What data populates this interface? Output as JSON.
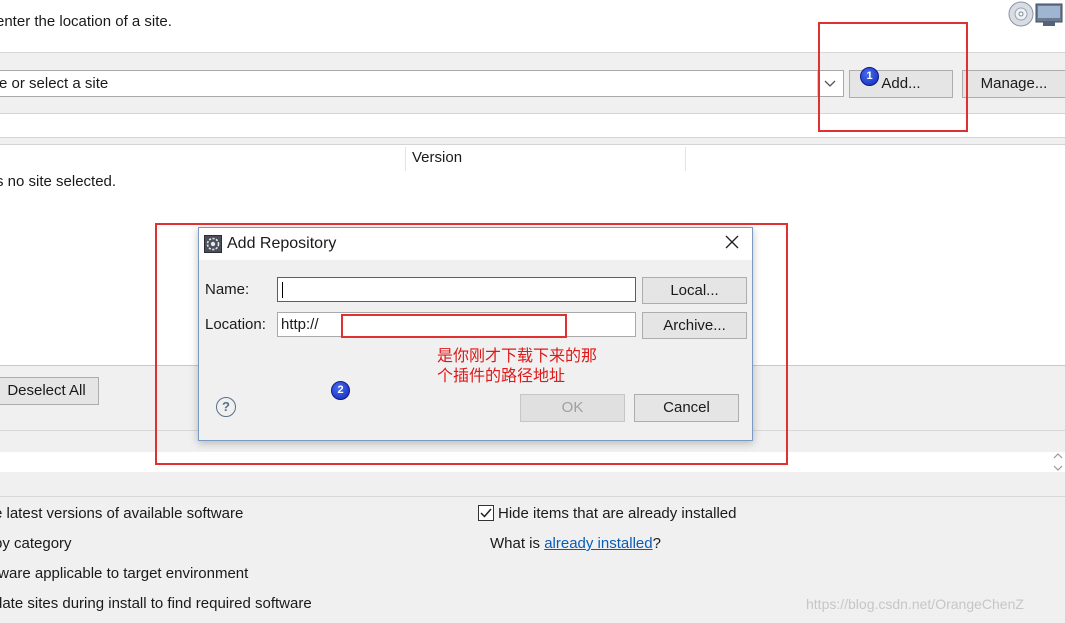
{
  "header": {
    "instruction": "enter the location of a site."
  },
  "site_selector": {
    "text": "e or select a site",
    "dropdown_icon": "chevron-down-icon",
    "add_label": "Add...",
    "manage_label": "Manage..."
  },
  "table": {
    "columns": [
      "Version"
    ],
    "empty_message": "s no site selected."
  },
  "actions": {
    "deselect_all_label": "Deselect All"
  },
  "options": {
    "items": [
      "e latest versions of available software",
      "by category",
      "tware applicable to target environment",
      "date sites during install to find required software"
    ],
    "hide_installed": {
      "label": "Hide items that are already installed",
      "checked": true
    },
    "what_is_prefix": "What is ",
    "already_installed_link": "already installed",
    "what_is_suffix": "?"
  },
  "dialog": {
    "title": "Add Repository",
    "close_icon": "close-icon",
    "name_label": "Name:",
    "name_value": "",
    "local_label": "Local...",
    "location_label": "Location:",
    "location_value": "http://",
    "archive_label": "Archive...",
    "help_icon": "help-icon",
    "ok_label": "OK",
    "cancel_label": "Cancel"
  },
  "annotations": {
    "step_1": "1",
    "step_2": "2",
    "note": "是你刚才下载下来的那个插件的路径地址",
    "highlight_color": "#e03030"
  },
  "watermark": "https://blog.csdn.net/OrangeChenZ",
  "colors": {
    "link": "#0b5bb5",
    "dialog_border": "#7a99c3",
    "focus_border": "#0078d7",
    "badge": "#1f3fd0"
  }
}
